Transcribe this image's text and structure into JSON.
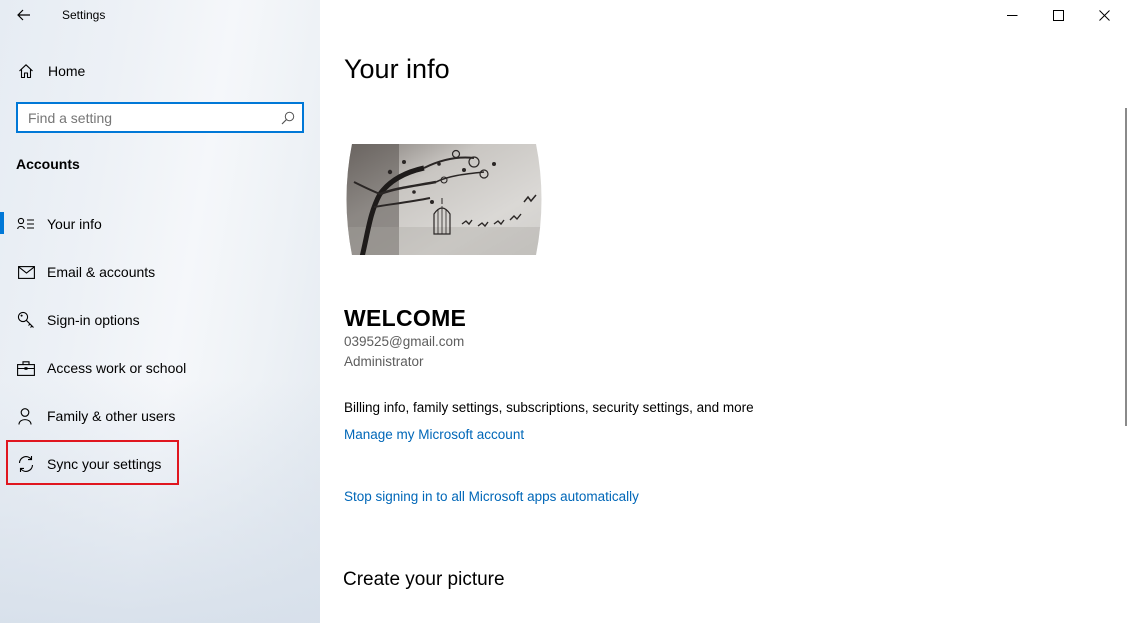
{
  "window": {
    "title": "Settings",
    "controls": {
      "minimize": "minimize",
      "maximize": "maximize",
      "close": "close"
    }
  },
  "sidebar": {
    "home_label": "Home",
    "search": {
      "placeholder": "Find a setting",
      "value": ""
    },
    "section_title": "Accounts",
    "items": [
      {
        "label": "Your info",
        "icon": "user-info-icon",
        "active": true
      },
      {
        "label": "Email & accounts",
        "icon": "mail-icon",
        "active": false
      },
      {
        "label": "Sign-in options",
        "icon": "key-icon",
        "active": false
      },
      {
        "label": "Access work or school",
        "icon": "briefcase-icon",
        "active": false
      },
      {
        "label": "Family & other users",
        "icon": "person-add-icon",
        "active": false
      },
      {
        "label": "Sync your settings",
        "icon": "sync-icon",
        "active": false,
        "highlighted": true
      }
    ]
  },
  "main": {
    "page_title": "Your info",
    "user": {
      "name": "WELCOME",
      "email": "039525@gmail.com",
      "role": "Administrator"
    },
    "billing_text": "Billing info, family settings, subscriptions, security settings, and more",
    "manage_link": "Manage my Microsoft account",
    "stop_signing_link": "Stop signing in to all Microsoft apps automatically",
    "create_picture_heading": "Create your picture"
  },
  "colors": {
    "accent": "#0078d7",
    "link": "#0067b8",
    "highlight_border": "#e0161f",
    "secondary_text": "#5d5d5d"
  }
}
